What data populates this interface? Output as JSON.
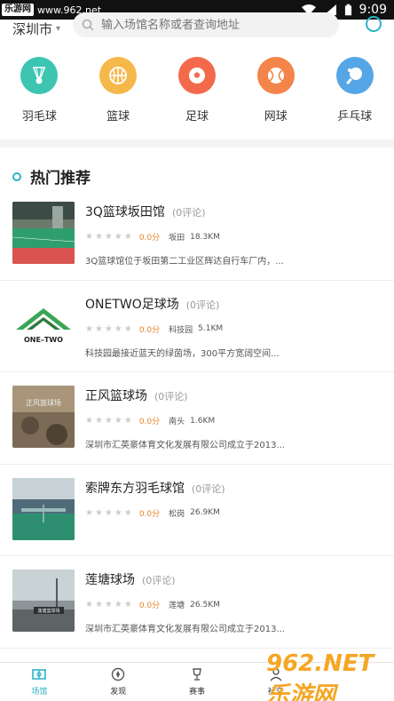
{
  "status_bar": {
    "watermark_logo": "乐游网",
    "watermark_url": "www.962.net",
    "time": "9:09",
    "icons": [
      "wifi-icon",
      "signal-icon",
      "battery-icon"
    ]
  },
  "top": {
    "city": "深圳市",
    "search_placeholder": "输入场馆名称或者查询地址"
  },
  "categories": [
    {
      "label": "羽毛球",
      "icon": "badminton-icon",
      "color": "#3dc5b2"
    },
    {
      "label": "篮球",
      "icon": "basketball-icon",
      "color": "#f6b84a"
    },
    {
      "label": "足球",
      "icon": "soccer-icon",
      "color": "#f26a4b"
    },
    {
      "label": "网球",
      "icon": "tennis-icon",
      "color": "#f3844a"
    },
    {
      "label": "乒乓球",
      "icon": "pingpong-icon",
      "color": "#55a6e6"
    }
  ],
  "section_title": "热门推荐",
  "venues": [
    {
      "name": "3Q篮球坂田馆",
      "reviews": "(0评论)",
      "score": "0.0分",
      "area": "坂田",
      "distance": "18.3KM",
      "desc": "3Q篮球馆位于坂田第二工业区辉达自行车厂内，..."
    },
    {
      "name": "ONETWO足球场",
      "reviews": "(0评论)",
      "score": "0.0分",
      "area": "科技园",
      "distance": "5.1KM",
      "desc": "科技园最接近蓝天的绿茵场，300平方宽阔空间..."
    },
    {
      "name": "正风篮球场",
      "reviews": "(0评论)",
      "score": "0.0分",
      "area": "南头",
      "distance": "1.6KM",
      "desc": "深圳市汇英豪体育文化发展有限公司成立于2013..."
    },
    {
      "name": "索牌东方羽毛球馆",
      "reviews": "(0评论)",
      "score": "0.0分",
      "area": "松岗",
      "distance": "26.9KM",
      "desc": ""
    },
    {
      "name": "莲塘球场",
      "reviews": "(0评论)",
      "score": "0.0分",
      "area": "莲塘",
      "distance": "26.5KM",
      "desc": "深圳市汇英豪体育文化发展有限公司成立于2013..."
    }
  ],
  "thumb_text": {
    "onetwo": "ONE–TWO",
    "zhengfeng": "正风篮球场",
    "liantang": "莲塘篮球场"
  },
  "stars": "★★★★★",
  "bottom_nav": [
    {
      "label": "场馆",
      "icon": "venue-icon",
      "active": true
    },
    {
      "label": "发现",
      "icon": "discover-icon",
      "active": false
    },
    {
      "label": "赛事",
      "icon": "trophy-icon",
      "active": false
    },
    {
      "label": "社交",
      "icon": "social-icon",
      "active": false
    }
  ],
  "watermark_bottom": "962.NET 乐游网",
  "accent": "#2db3c6"
}
